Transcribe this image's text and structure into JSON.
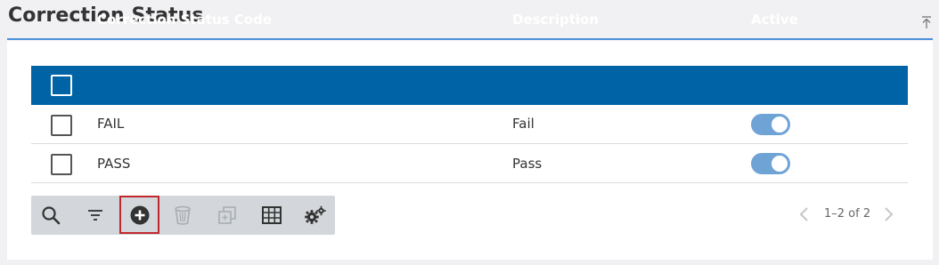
{
  "page": {
    "title": "Correction Status"
  },
  "table": {
    "columns": {
      "code": "Correction Status Code",
      "description": "Description",
      "active": "Active"
    },
    "rows": [
      {
        "code": "FAIL",
        "description": "Fail",
        "active": true
      },
      {
        "code": "PASS",
        "description": "Pass",
        "active": true
      }
    ]
  },
  "toolbar": {
    "buttons": [
      {
        "icon": "search-icon"
      },
      {
        "icon": "filter-icon"
      },
      {
        "icon": "add-icon",
        "selected": true
      },
      {
        "icon": "delete-icon",
        "disabled": true
      },
      {
        "icon": "copy-icon",
        "disabled": true
      },
      {
        "icon": "grid-icon"
      },
      {
        "icon": "settings-icon"
      }
    ]
  },
  "pager": {
    "text": "1–2 of 2"
  },
  "colors": {
    "header_blue": "#0063a5",
    "title_rule": "#4a90d9",
    "toggle_on": "#6fa3d6",
    "selected_outline": "#c0282d"
  }
}
